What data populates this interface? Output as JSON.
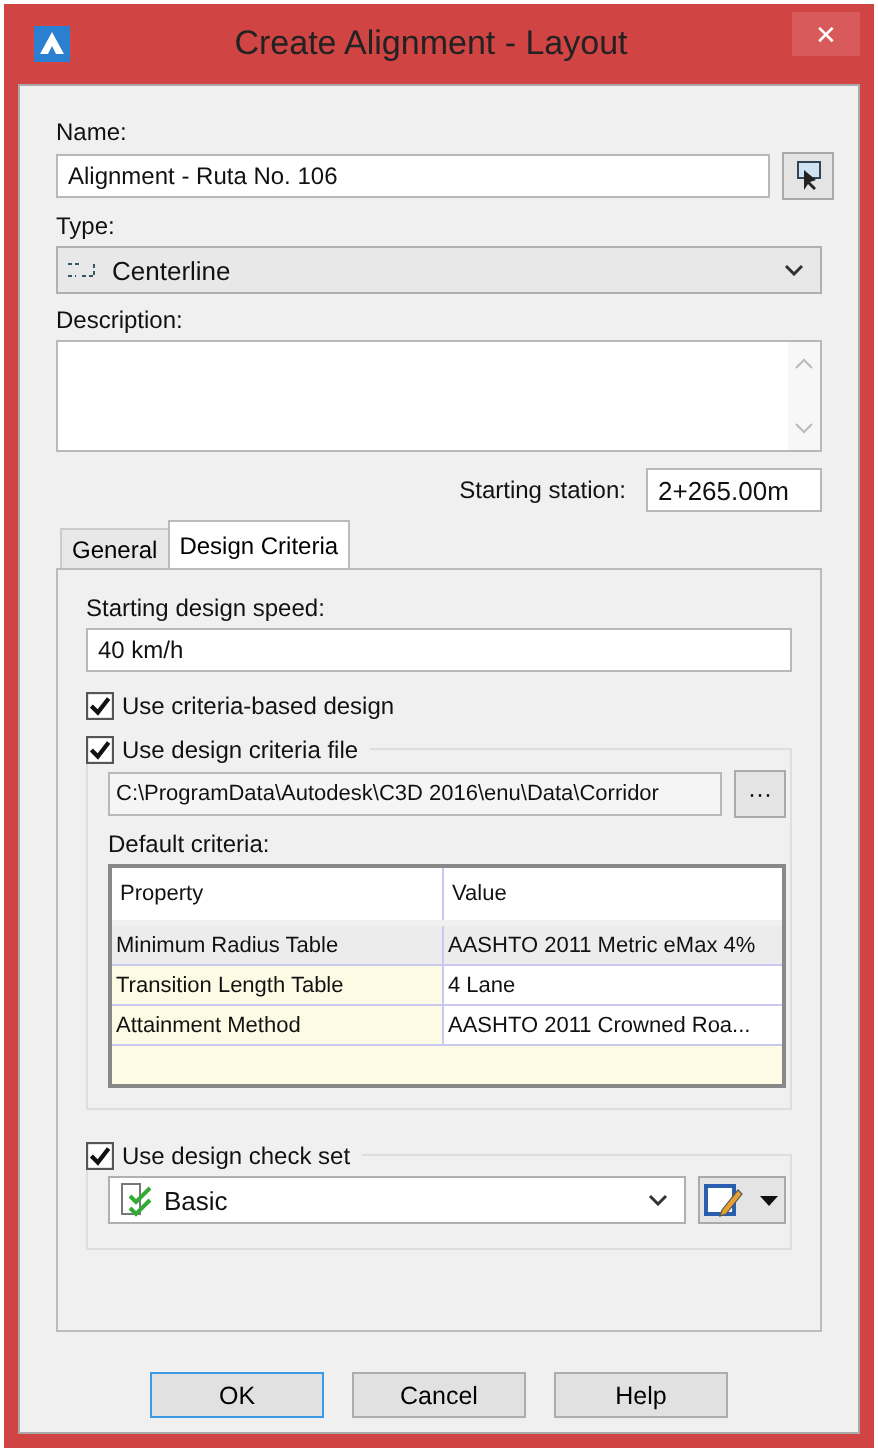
{
  "window": {
    "title": "Create Alignment - Layout",
    "close": "✕"
  },
  "name": {
    "label": "Name:",
    "value": "Alignment - Ruta No. 106"
  },
  "type": {
    "label": "Type:",
    "value": "Centerline"
  },
  "description": {
    "label": "Description:"
  },
  "starting_station": {
    "label": "Starting station:",
    "value": "2+265.00m"
  },
  "tabs": [
    {
      "label": "General",
      "selected": false
    },
    {
      "label": "Design Criteria",
      "selected": true
    }
  ],
  "design_speed": {
    "label": "Starting design speed:",
    "value": "40 km/h"
  },
  "criteria_based": {
    "label": "Use criteria-based design",
    "checked": true
  },
  "criteria_file": {
    "label": "Use design criteria file",
    "checked": true,
    "path": "C:\\ProgramData\\Autodesk\\C3D 2016\\enu\\Data\\Corridor",
    "browse": "···"
  },
  "default_criteria": {
    "label": "Default criteria:",
    "columns": [
      "Property",
      "Value"
    ],
    "rows": [
      {
        "property": "Minimum Radius Table",
        "value": "AASHTO 2011 Metric eMax 4%",
        "selected": true
      },
      {
        "property": "Transition Length Table",
        "value": "4 Lane",
        "selected": false
      },
      {
        "property": "Attainment Method",
        "value": "AASHTO 2011 Crowned Roa...",
        "selected": false
      }
    ]
  },
  "check_set": {
    "label": "Use design check set",
    "checked": true,
    "value": "Basic"
  },
  "buttons": [
    {
      "label": "OK",
      "selected": true
    },
    {
      "label": "Cancel",
      "selected": false
    },
    {
      "label": "Help",
      "selected": false
    }
  ]
}
